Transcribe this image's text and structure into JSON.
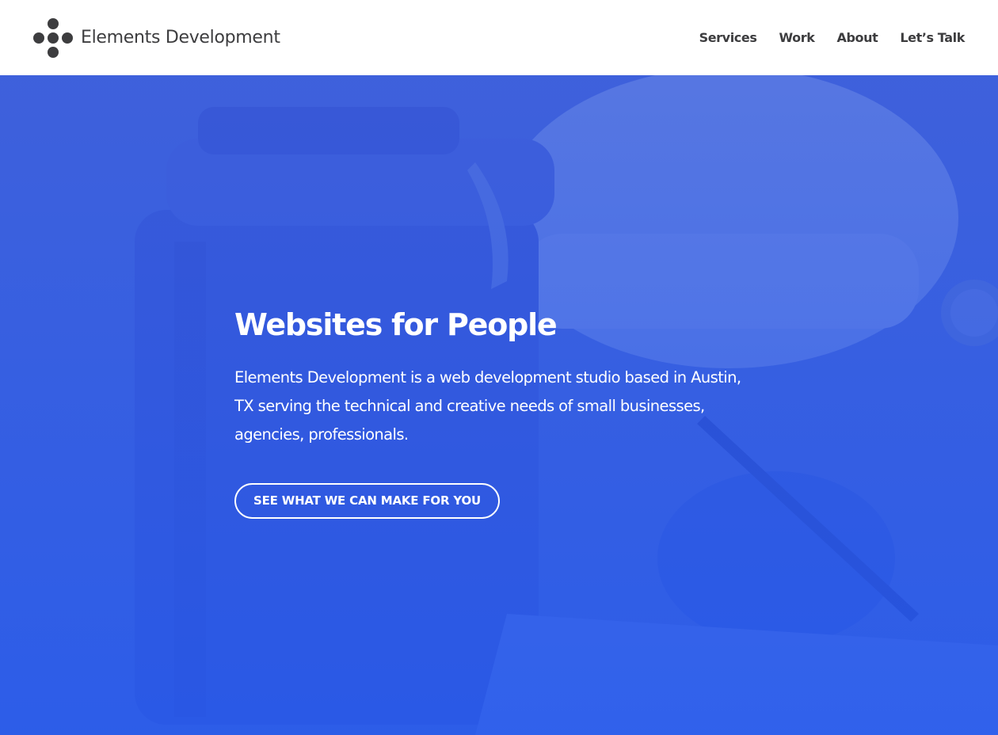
{
  "brand": {
    "name": "Elements Development",
    "logo_icon": "five-dot-cross-logo"
  },
  "nav": {
    "items": [
      {
        "label": "Services"
      },
      {
        "label": "Work"
      },
      {
        "label": "About"
      },
      {
        "label": "Let’s Talk"
      }
    ]
  },
  "hero": {
    "title": "Websites for People",
    "description": "Elements Development is a web development studio based in Austin, TX serving the technical and creative needs of small businesses, agencies, professionals.",
    "cta_label": "SEE WHAT WE CAN MAKE FOR YOU",
    "background_image": "leather-case-and-hand-writing-photo"
  },
  "colors": {
    "header_bg": "#ffffff",
    "logo_text": "#3d3d3f",
    "hero_tint": "#2e5ce6",
    "hero_text": "#ffffff"
  }
}
